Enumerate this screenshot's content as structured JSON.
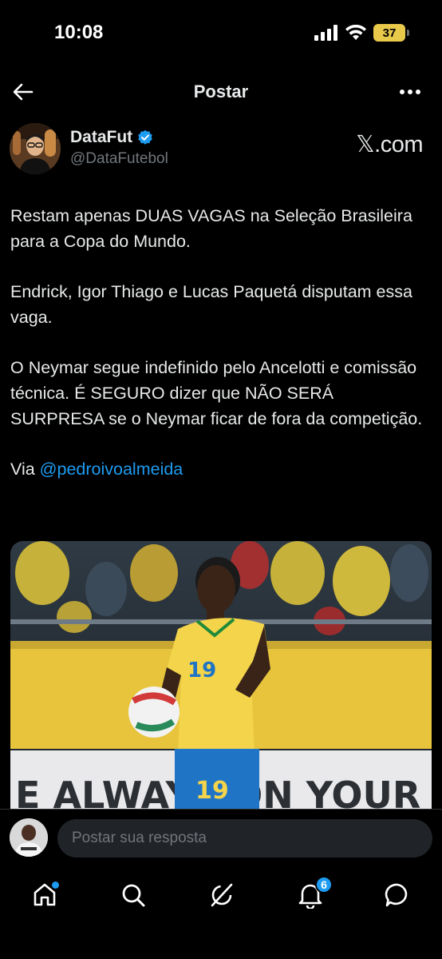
{
  "status_bar": {
    "time": "10:08",
    "battery": "37"
  },
  "header": {
    "title": "Postar"
  },
  "post": {
    "author_name": "DataFut",
    "author_handle": "@DataFutebol",
    "source": "𝕏.com",
    "paragraphs": [
      "Restam apenas DUAS VAGAS na Seleção Brasileira para a Copa do Mundo.",
      "Endrick, Igor Thiago e Lucas Paquetá disputam essa vaga.",
      "O Neymar segue indefinido pelo Ancelotti e comissão técnica. É SEGURO dizer que NÃO SERÁ SURPRESA se o Neymar ficar de fora da competição."
    ],
    "via_prefix": "Via ",
    "via_mention": "@pedroivoalmeida",
    "media": {
      "banner_text": "E ALWAYS ON YOUR",
      "jersey_number": "19"
    }
  },
  "reply": {
    "placeholder": "Postar sua resposta"
  },
  "tab_bar": {
    "notifications_badge": "6"
  },
  "colors": {
    "accent": "#1d9bf0",
    "background": "#000000",
    "muted": "#71767b",
    "jersey_yellow": "#f3d44a",
    "shorts_blue": "#1f74c6"
  }
}
